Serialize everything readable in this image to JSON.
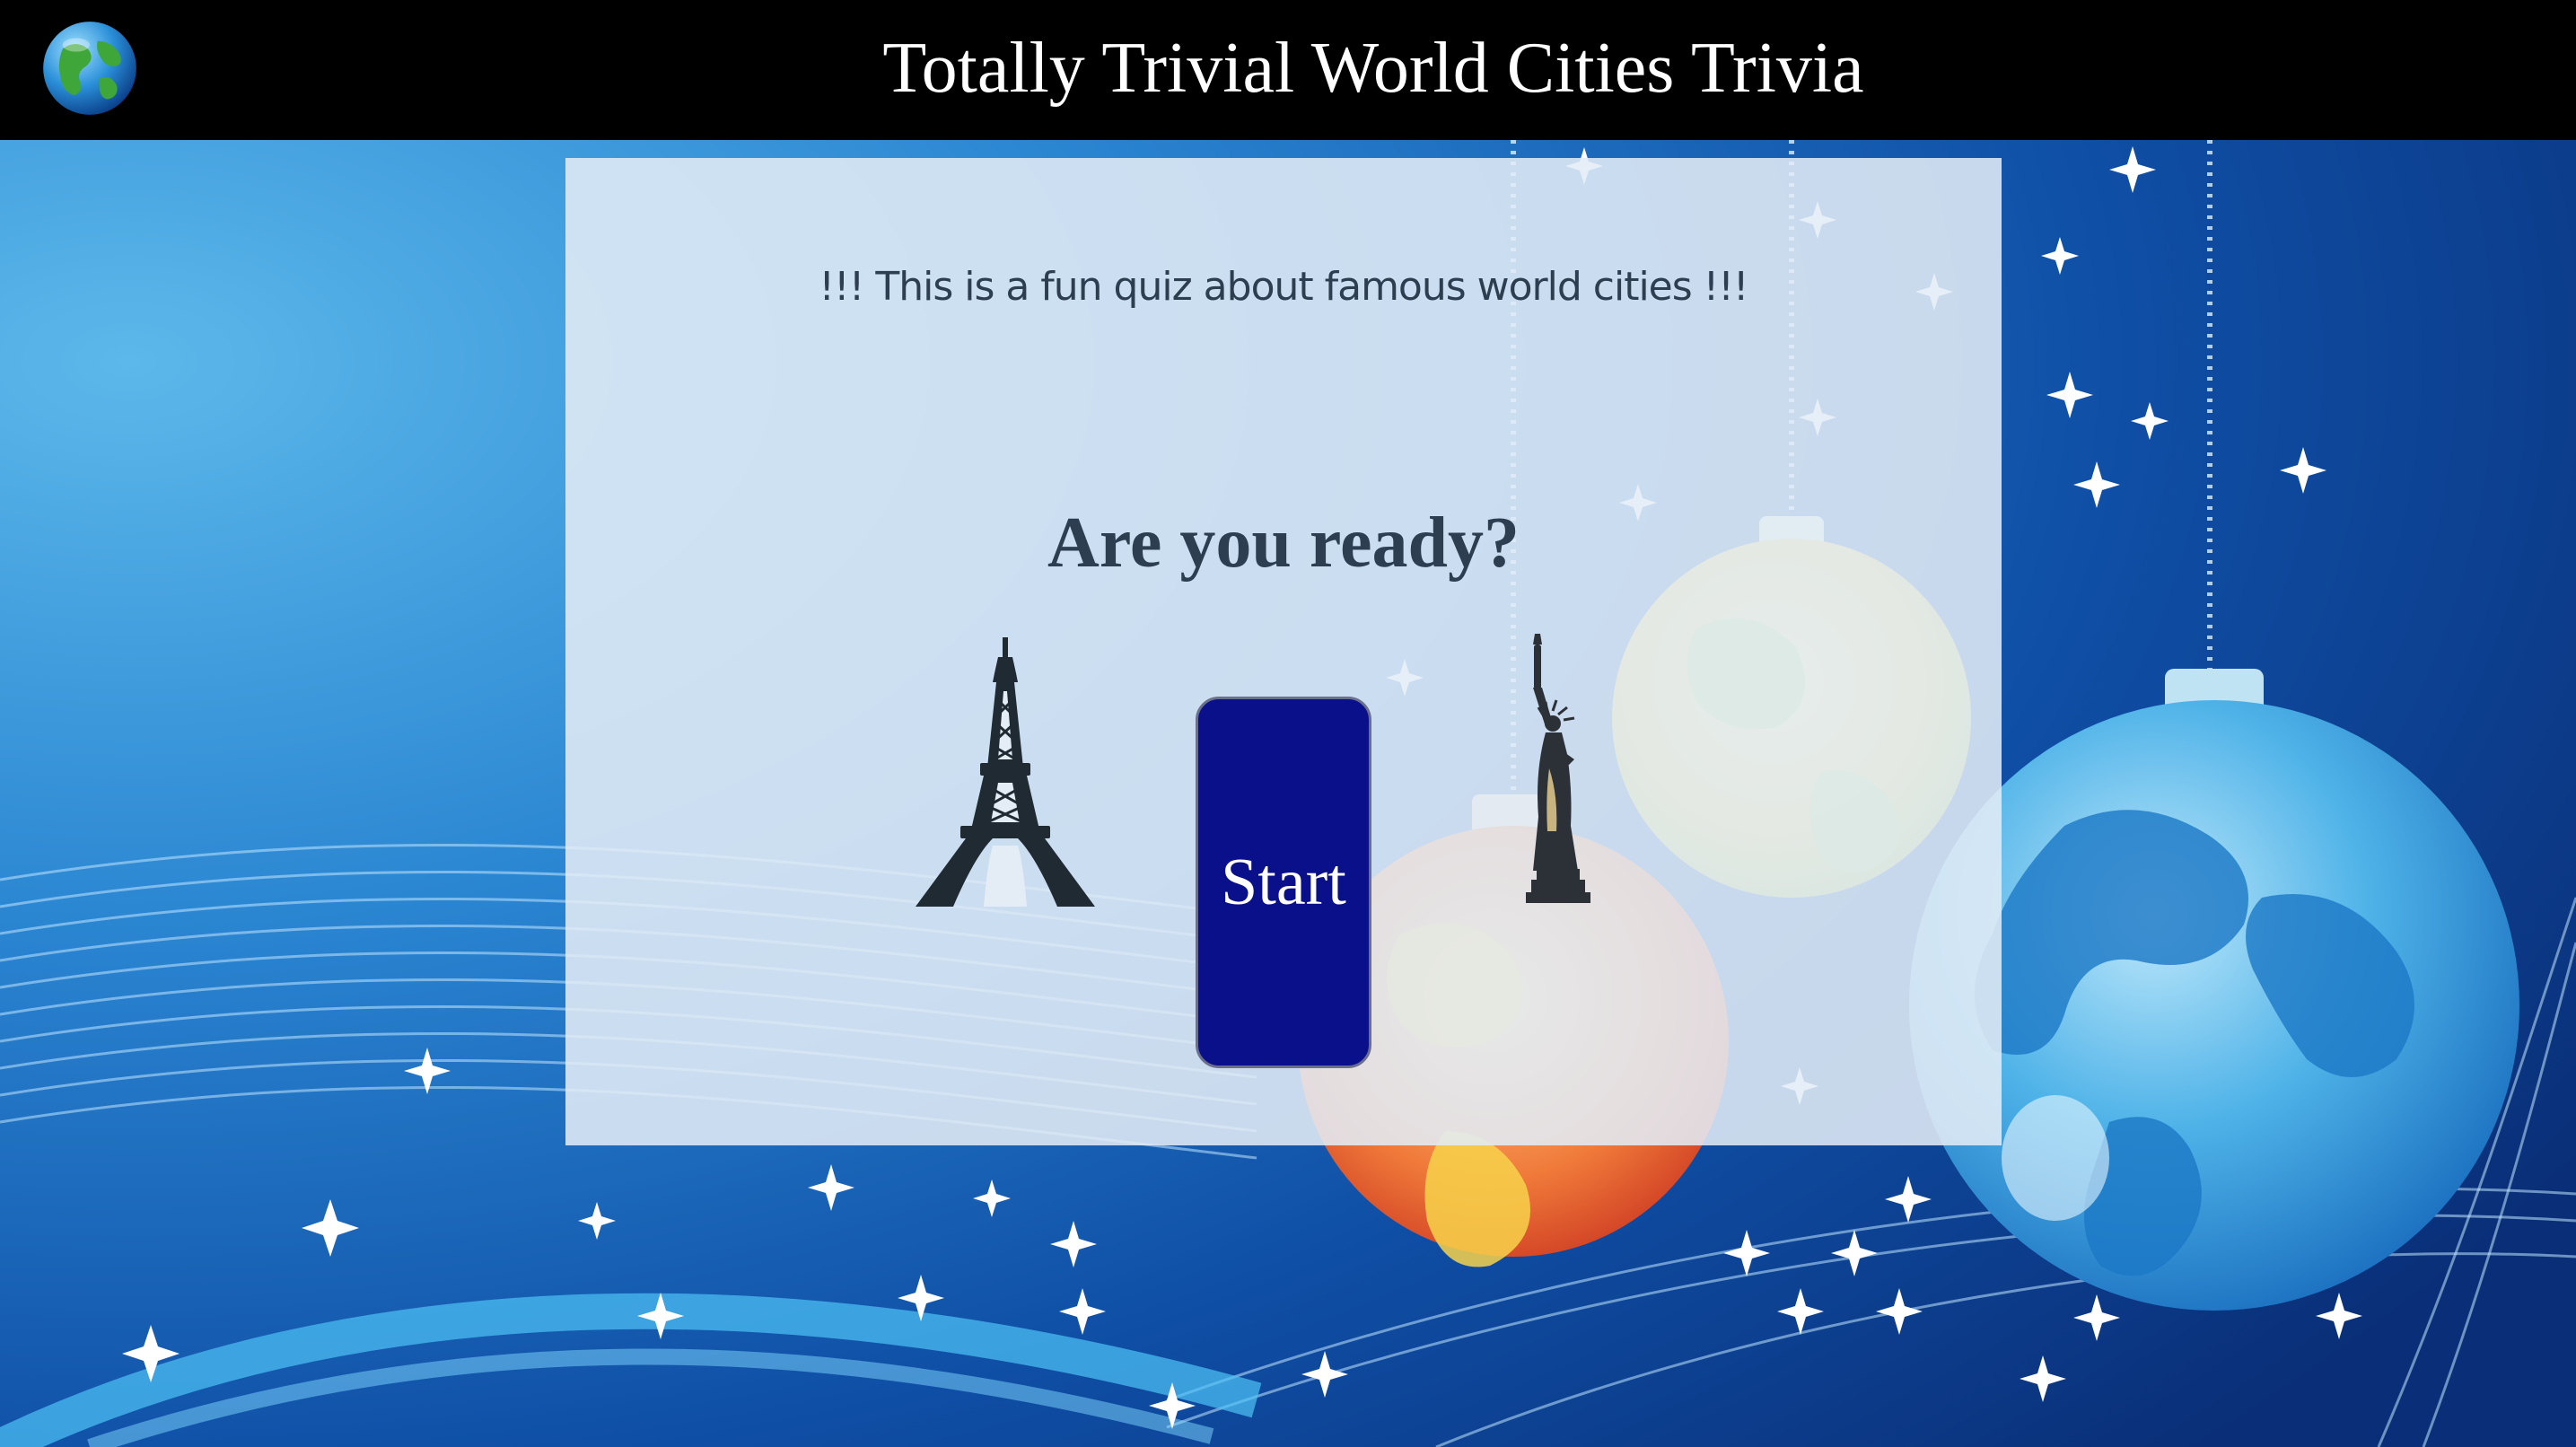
{
  "header": {
    "title": "Totally Trivial World Cities Trivia",
    "logo_icon": "globe-icon",
    "background": "#000000",
    "text_color": "#ffffff"
  },
  "quiz_card": {
    "subtitle": "!!! This is a fun quiz about famous world cities !!!",
    "prompt": "Are you ready?",
    "start_label": "Start",
    "left_icon": "eiffel-tower-icon",
    "right_icon": "statue-of-liberty-icon",
    "text_color": "#2c3e50",
    "button_color": "#0a0f8a"
  },
  "background": {
    "theme": "blue-starry-sky-with-globe-ornaments",
    "base_color": "#0d3f8f"
  }
}
